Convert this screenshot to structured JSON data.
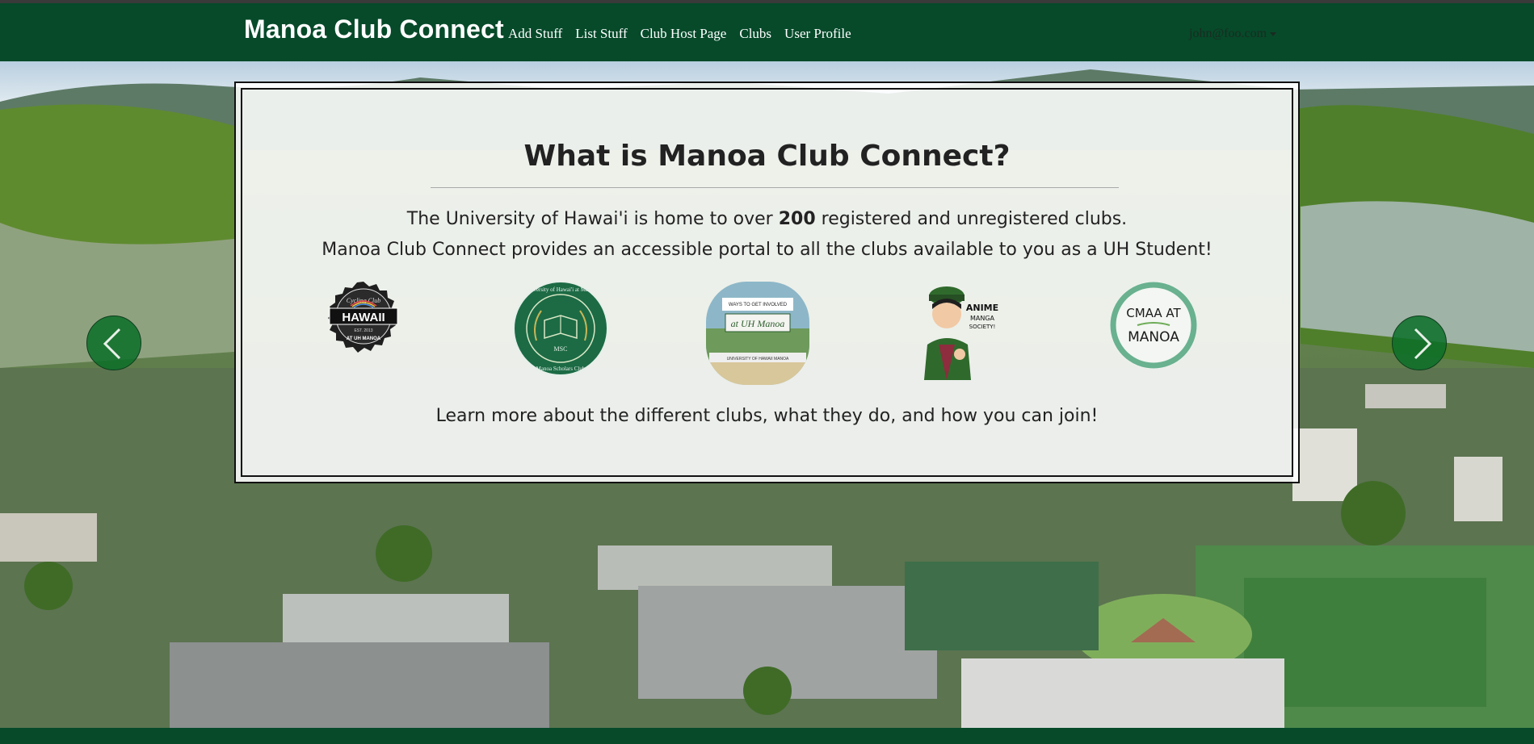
{
  "navbar": {
    "brand": "Manoa Club Connect",
    "links": [
      "Add Stuff",
      "List Stuff",
      "Club Host Page",
      "Clubs",
      "User Profile"
    ],
    "user": "john@foo.com"
  },
  "hero": {
    "title": "What is Manoa Club Connect?",
    "line1_before": "The University of Hawai'i is home to over ",
    "line1_number": "200",
    "line1_after": " registered and unregistered clubs.",
    "line2": "Manoa Club Connect provides an accessible portal to all the clubs available to you as a UH Student!",
    "learn_more": "Learn more about the different clubs, what they do, and how you can join!"
  },
  "logos": [
    {
      "name": "cycling-club-logo",
      "top_text": "Cycling Club",
      "main": "HAWAII",
      "sub": "EST. 2013",
      "bottom_text": "AT UH MANOA"
    },
    {
      "name": "manoa-scholars-club-logo",
      "ring_text": "University of Hawai'i at Manoa",
      "center": "MSC",
      "bottom_text": "Manoa Scholars Club"
    },
    {
      "name": "ways-to-get-involved-logo",
      "sign": "WAYS TO GET INVOLVED",
      "script": "at UH Manoa",
      "banner": "UNIVERSITY OF HAWAII MANOA"
    },
    {
      "name": "anime-manga-society-logo",
      "text1": "ANIME",
      "text2": "MANGA",
      "text3": "SOCIETY!"
    },
    {
      "name": "cmaa-at-manoa-logo",
      "line1": "CMAA AT",
      "line2": "MANOA"
    }
  ],
  "colors": {
    "navbar": "#064a2a",
    "accent_green": "#1c7a3e",
    "text_dark": "#222222"
  },
  "icons": {
    "prev": "chevron-left-icon",
    "next": "chevron-right-icon",
    "dropdown": "caret-down-icon"
  }
}
